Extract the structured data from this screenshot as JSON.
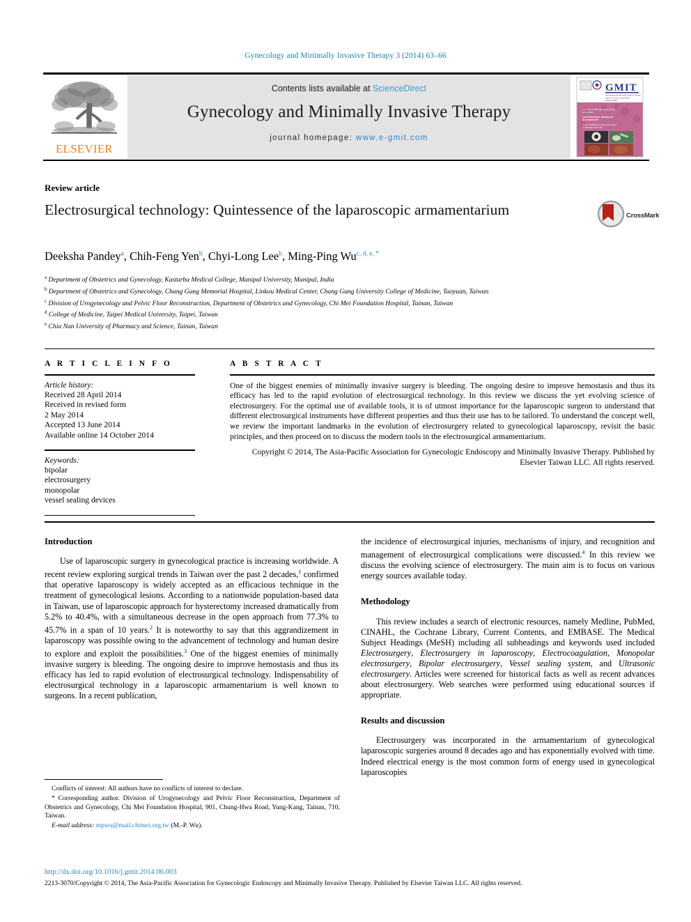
{
  "running_head": "Gynecology and Minimally Invasive Therapy 3 (2014) 63–66",
  "masthead": {
    "contents_prefix": "Contents lists available at ",
    "sciencedirect": "ScienceDirect",
    "journal_title": "Gynecology and Minimally Invasive Therapy",
    "homepage_label": "journal homepage: ",
    "homepage_url": "www.e-gmit.com",
    "publisher_wordmark": "ELSEVIER",
    "cover_title": "GMIT",
    "cover_sub": "Gynecology and Minimally Invasive Therapy",
    "cover_meta": "Volume 3  Issue 3  August 2014",
    "cover_issn": "ISSN 2213-3070",
    "cover_site": "www.elsevier.com/locate/gmit"
  },
  "article": {
    "type": "Review article",
    "title": "Electrosurgical technology: Quintessence of the laparoscopic armamentarium",
    "authors": [
      {
        "name": "Deeksha Pandey",
        "marks": "a",
        "sep": ", "
      },
      {
        "name": "Chih-Feng Yen",
        "marks": "b",
        "sep": ", "
      },
      {
        "name": "Chyi-Long Lee",
        "marks": "b",
        "sep": ", "
      },
      {
        "name": "Ming-Ping Wu",
        "marks": "c, d, e, *",
        "sep": ""
      }
    ],
    "affiliations": [
      {
        "mark": "a",
        "text": "Department of Obstetrics and Gynecology, Kasturba Medical College, Manipal University, Manipal, India"
      },
      {
        "mark": "b",
        "text": "Department of Obstetrics and Gynecology, Chang Gung Memorial Hospital, Linkou Medical Center, Chang Gung University College of Medicine, Taoyuan, Taiwan"
      },
      {
        "mark": "c",
        "text": "Division of Urogynecology and Pelvic Floor Reconstruction, Department of Obstetrics and Gynecology, Chi Mei Foundation Hospital, Tainan, Taiwan"
      },
      {
        "mark": "d",
        "text": "College of Medicine, Taipei Medical University, Taipei, Taiwan"
      },
      {
        "mark": "e",
        "text": "Chia Nan University of Pharmacy and Science, Tainan, Taiwan"
      }
    ],
    "crossmark_label": "CrossMark"
  },
  "info": {
    "heading": "A R T I C L E   I N F O",
    "history_label": "Article history:",
    "history": [
      "Received 28 April 2014",
      "Received in revised form",
      "2 May 2014",
      "Accepted 13 June 2014",
      "Available online 14 October 2014"
    ],
    "keywords_label": "Keywords:",
    "keywords": [
      "bipolar",
      "electrosurgery",
      "monopolar",
      "vessel sealing devices"
    ]
  },
  "abstract": {
    "heading": "A B S T R A C T",
    "body": "One of the biggest enemies of minimally invasive surgery is bleeding. The ongoing desire to improve hemostasis and thus its efficacy has led to the rapid evolution of electrosurgical technology. In this review we discuss the yet evolving science of electrosurgery. For the optimal use of available tools, it is of utmost importance for the laparoscopic surgeon to understand that different electrosurgical instruments have different properties and thus their use has to be tailored. To understand the concept well, we review the important landmarks in the evolution of electrosurgery related to gynecological laparoscopy, revisit the basic principles, and then proceed on to discuss the modern tools in the electrosurgical armamentarium.",
    "copyright": "Copyright © 2014, The Asia-Pacific Association for Gynecologic Endoscopy and Minimally Invasive Therapy. Published by Elsevier Taiwan LLC. All rights reserved."
  },
  "body": {
    "left": {
      "h_intro": "Introduction",
      "p1_a": "Use of laparoscopic surgery in gynecological practice is increasing worldwide. A recent review exploring surgical trends in Taiwan over the past 2 decades,",
      "p1_r1": "1",
      "p1_b": " confirmed that operative laparoscopy is widely accepted as an efficacious technique in the treatment of gynecological lesions. According to a nationwide population-based data in Taiwan, use of laparoscopic approach for hysterectomy increased dramatically from 5.2% to 40.4%, with a simultaneous decrease in the open approach from 77.3% to 45.7% in a span of 10 years.",
      "p1_r2": "2",
      "p1_c": " It is noteworthy to say that this aggrandizement in laparoscopy was possible owing to the advancement of technology and human desire to explore and exploit the possibilities.",
      "p1_r3": "3",
      "p1_d": " One of the biggest enemies of minimally invasive surgery is bleeding. The ongoing desire to improve hemostasis and thus its efficacy has led to rapid evolution of electrosurgical technology. Indispensability of electrosurgical technology in a laparoscopic armamentarium is well known to surgeons. In a recent publication,"
    },
    "right": {
      "p_cont_a": "the incidence of electrosurgical injuries, mechanisms of injury, and recognition and management of electrosurgical complications were discussed.",
      "p_cont_r4": "4",
      "p_cont_b": " In this review we discuss the evolving science of electrosurgery. The main aim is to focus on various energy sources available today.",
      "h_method": "Methodology",
      "method_a": "This review includes a search of electronic resources, namely Medline, PubMed, CINAHL, the Cochrane Library, Current Contents, and EMBASE. The Medical Subject Headings (MeSH) including all subheadings and keywords used included ",
      "mesh_1": "Electrosurgery",
      "mesh_2": "Electrosurgery in laparoscopy",
      "mesh_3": "Electrocoagulation",
      "mesh_4": "Monopolar electrosurgery",
      "mesh_5": "Bipolar electrosurgery",
      "mesh_6": "Vessel sealing system",
      "mesh_7": "Ultrasonic electrosurgery",
      "method_b": ". Articles were screened for historical facts as well as recent advances about electrosurgery. Web searches were performed using educational sources if appropriate.",
      "h_results": "Results and discussion",
      "results_a": "Electrosurgery was incorporated in the armamentarium of gynecological laparoscopic surgeries around 8 decades ago and has exponentially evolved with time. Indeed electrical energy is the most common form of energy used in gynecological laparoscopies"
    }
  },
  "footnotes": {
    "conflicts": "Conflicts of interest: All authors have no conflicts of interest to declare.",
    "corresponding": "* Corresponding author. Division of Urogynecology and Pelvic Floor Reconstruction, Department of Obstetrics and Gynecology, Chi Mei Foundation Hospital, 901, Chung-Hwa Road, Yung-Kang, Tainan, 710, Taiwan.",
    "email_label": "E-mail address:",
    "email": "mpwu@mail.chimei.org.tw",
    "email_suffix": " (M.-P. Wu)."
  },
  "bottom": {
    "doi": "http://dx.doi.org/10.1016/j.gmit.2014.06.003",
    "issn_line": "2213-3070/Copyright © 2014, The Asia-Pacific Association for Gynecologic Endoscopy and Minimally Invasive Therapy. Published by Elsevier Taiwan LLC. All rights reserved."
  },
  "colors": {
    "link_blue": "#2f86c5",
    "header_blue": "#1a7fb5",
    "elsevier_orange": "#f47c20",
    "banner_grey": "#e3e3e3",
    "crossmark_red": "#b32317"
  }
}
